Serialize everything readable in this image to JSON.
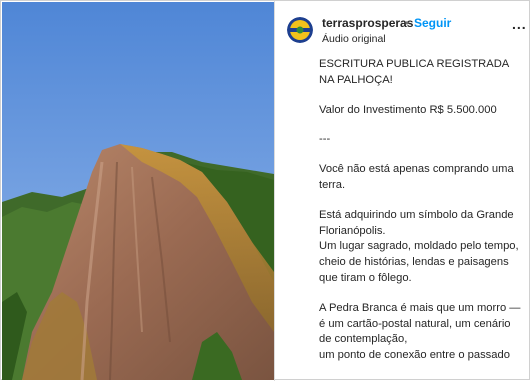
{
  "post": {
    "username": "terrasprosperas",
    "separator": "•",
    "follow_label": "Seguir",
    "audio_label": "Áudio original",
    "more_label": "...",
    "caption": [
      "ESCRITURA PUBLICA REGISTRADA NA PALHOÇA!",
      "Valor do Investimento R$ 5.500.000",
      "---",
      "Você não está apenas comprando uma terra.",
      "Está adquirindo um símbolo da Grande Florianópolis.\nUm lugar sagrado, moldado pelo tempo,\ncheio de histórias, lendas e paisagens que tiram o fôlego.",
      "A Pedra Branca é mais que um morro —\né um cartão-postal natural, um cenário de contemplação,\num ponto de conexão entre o passado"
    ]
  },
  "colors": {
    "link_blue": "#0095f6",
    "text": "#262626",
    "secondary": "#737373"
  },
  "icons": {
    "avatar": "logo-avatar-icon",
    "more": "more-options-icon"
  }
}
